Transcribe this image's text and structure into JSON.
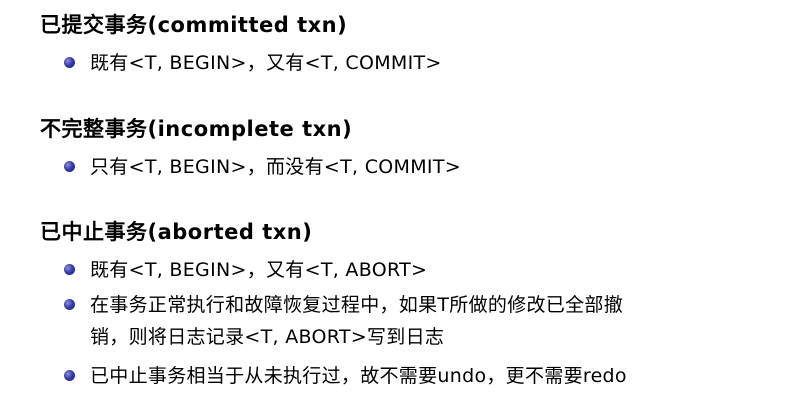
{
  "sections": [
    {
      "title": "已提交事务(committed txn)",
      "items": [
        "既有<T, BEGIN>，又有<T, COMMIT>"
      ]
    },
    {
      "title": "不完整事务(incomplete txn)",
      "items": [
        "只有<T, BEGIN>，而没有<T, COMMIT>"
      ]
    },
    {
      "title": "已中止事务(aborted txn)",
      "items": [
        "既有<T, BEGIN>，又有<T, ABORT>",
        "在事务正常执行和故障恢复过程中，如果T所做的修改已全部撤",
        "销，则将日志记录<T, ABORT>写到日志",
        "已中止事务相当于从未执行过，故不需要undo，更不需要redo"
      ]
    }
  ]
}
